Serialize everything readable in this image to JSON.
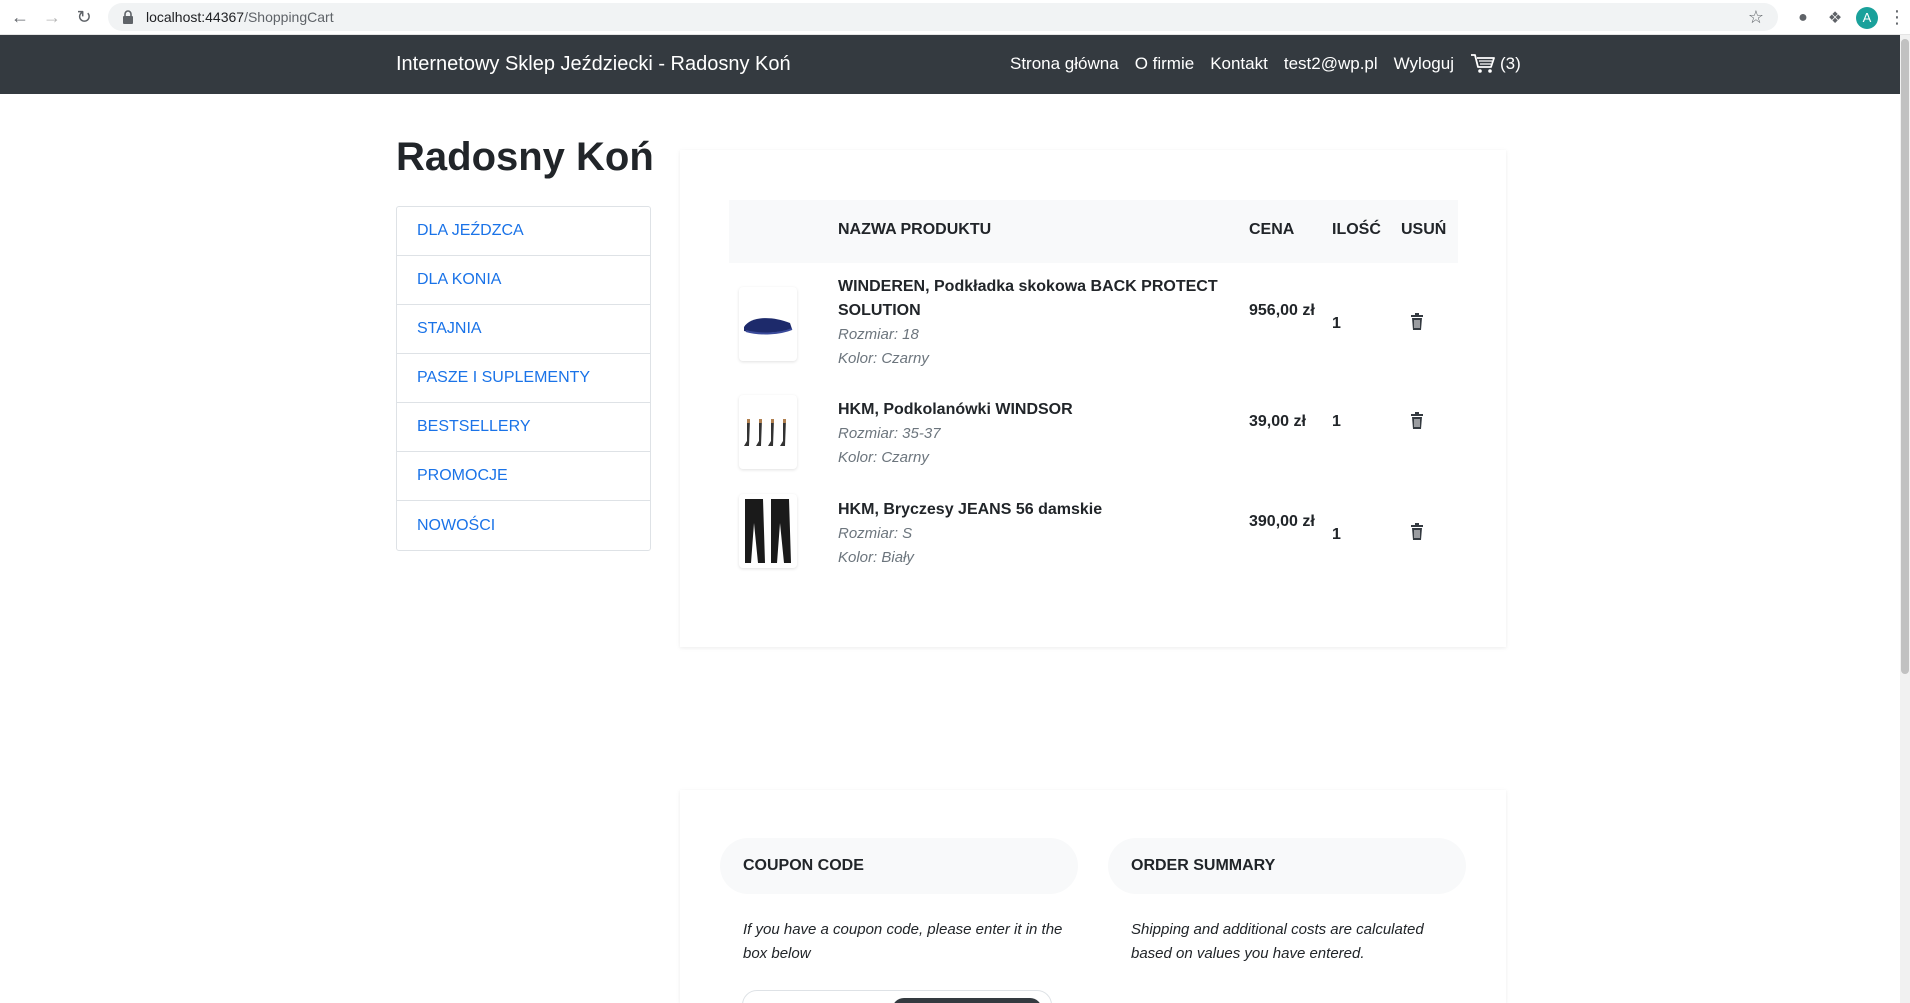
{
  "browser": {
    "url_host": "localhost:44367",
    "url_path": "/ShoppingCart",
    "avatar_letter": "A"
  },
  "navbar": {
    "brand": "Internetowy Sklep Jeździecki - Radosny Koń",
    "links": [
      "Strona główna",
      "O firmie",
      "Kontakt",
      "test2@wp.pl",
      "Wyloguj"
    ],
    "cart_count": "(3)"
  },
  "sidebar": {
    "title": "Radosny Koń",
    "categories": [
      "DLA JEŹDZCA",
      "DLA KONIA",
      "STAJNIA",
      "PASZE I SUPLEMENTY",
      "BESTSELLERY",
      "PROMOCJE",
      "NOWOŚCI"
    ]
  },
  "cart": {
    "headers": {
      "name": "NAZWA PRODUKTU",
      "price": "CENA",
      "qty": "ILOŚĆ",
      "remove": "USUŃ"
    },
    "items": [
      {
        "name": "WINDEREN, Podkładka skokowa BACK PROTECT SOLUTION",
        "size": "Rozmiar: 18",
        "color": "Kolor: Czarny",
        "price": "956,00 zł",
        "qty": "1",
        "image_icon": "saddle-pad-icon"
      },
      {
        "name": "HKM, Podkolanówki WINDSOR",
        "size": "Rozmiar: 35-37",
        "color": "Kolor: Czarny",
        "price": "39,00 zł",
        "qty": "1",
        "image_icon": "socks-icon"
      },
      {
        "name": "HKM, Bryczesy JEANS 56 damskie",
        "size": "Rozmiar: S",
        "color": "Kolor: Biały",
        "price": "390,00 zł",
        "qty": "1",
        "image_icon": "breeches-icon"
      }
    ]
  },
  "coupon": {
    "title": "COUPON CODE",
    "text": "If you have a coupon code, please enter it in the box below"
  },
  "summary": {
    "title": "ORDER SUMMARY",
    "text": "Shipping and additional costs are calculated based on values you have entered."
  }
}
